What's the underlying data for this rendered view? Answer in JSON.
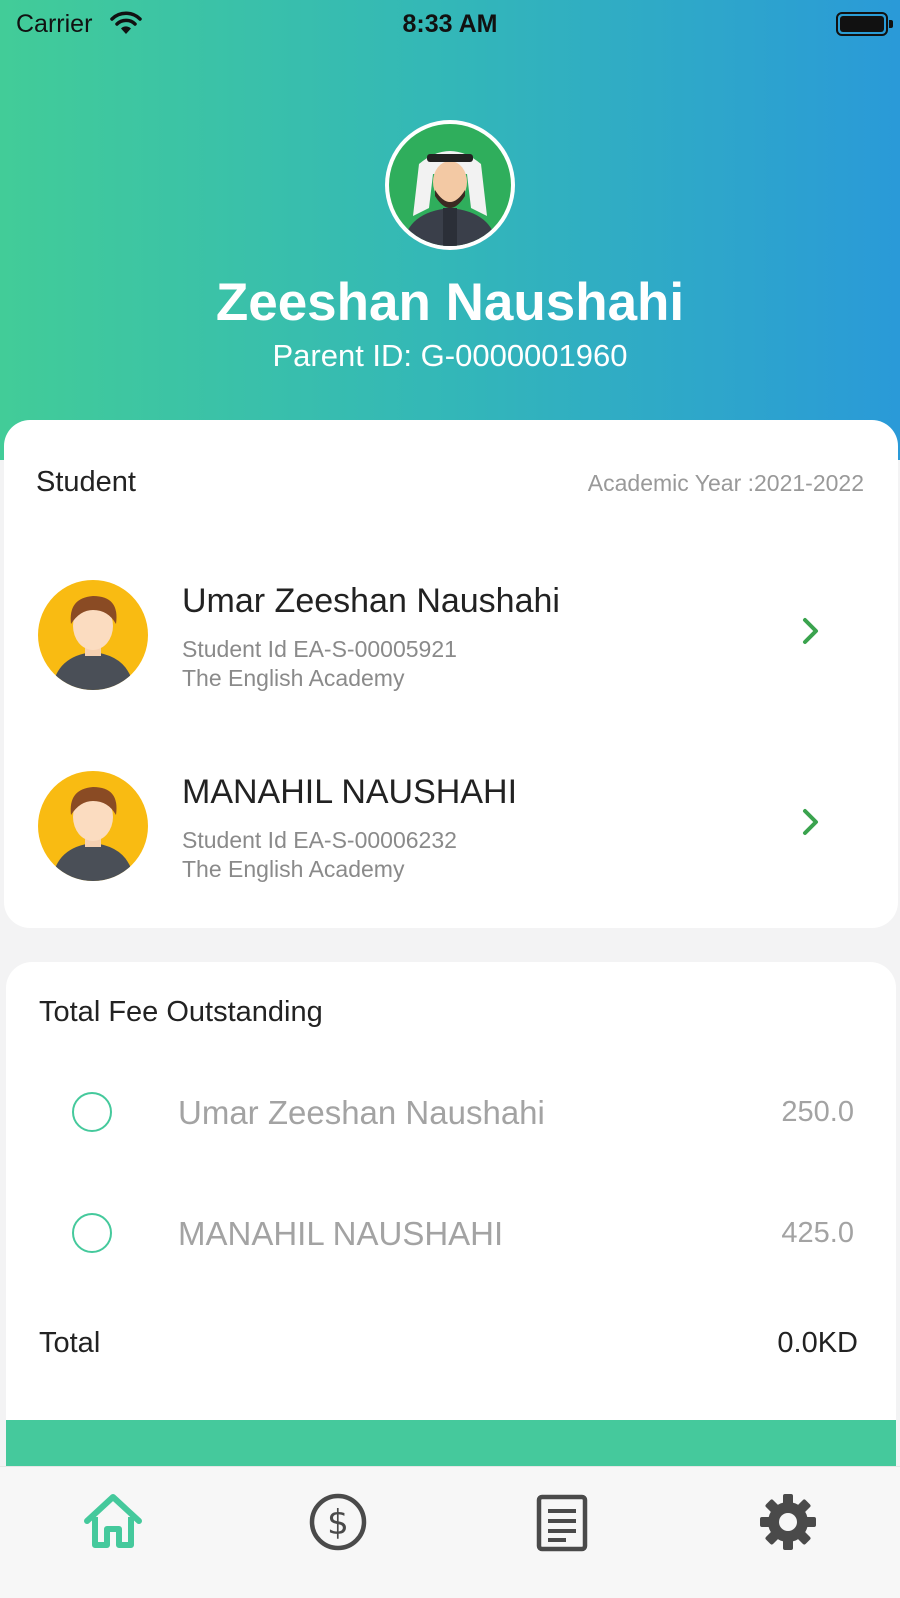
{
  "status_bar": {
    "carrier": "Carrier",
    "time": "8:33 AM"
  },
  "profile": {
    "name": "Zeeshan Naushahi",
    "parent_id": "Parent ID: G-0000001960"
  },
  "students_card": {
    "title": "Student",
    "academic_year": "Academic Year :2021-2022",
    "students": [
      {
        "name": "Umar Zeeshan Naushahi",
        "student_id": "Student Id EA-S-00005921",
        "school": "The English Academy"
      },
      {
        "name": "MANAHIL NAUSHAHI",
        "student_id": "Student Id EA-S-00006232",
        "school": "The English Academy"
      }
    ]
  },
  "fee_card": {
    "title": "Total Fee Outstanding",
    "items": [
      {
        "name": "Umar Zeeshan Naushahi",
        "amount": "250.0",
        "selected": false
      },
      {
        "name": "MANAHIL NAUSHAHI",
        "amount": "425.0",
        "selected": false
      }
    ],
    "total_label": "Total",
    "total_value": "0.0KD"
  },
  "tab_bar": {
    "tabs": [
      {
        "icon": "home-icon",
        "active": true
      },
      {
        "icon": "dollar-icon",
        "active": false
      },
      {
        "icon": "document-icon",
        "active": false
      },
      {
        "icon": "gear-icon",
        "active": false
      }
    ]
  },
  "colors": {
    "accent": "#45c99c",
    "gradient_start": "#42cc98",
    "gradient_end": "#2a9ad8",
    "avatar_bg": "#f9bb12"
  }
}
